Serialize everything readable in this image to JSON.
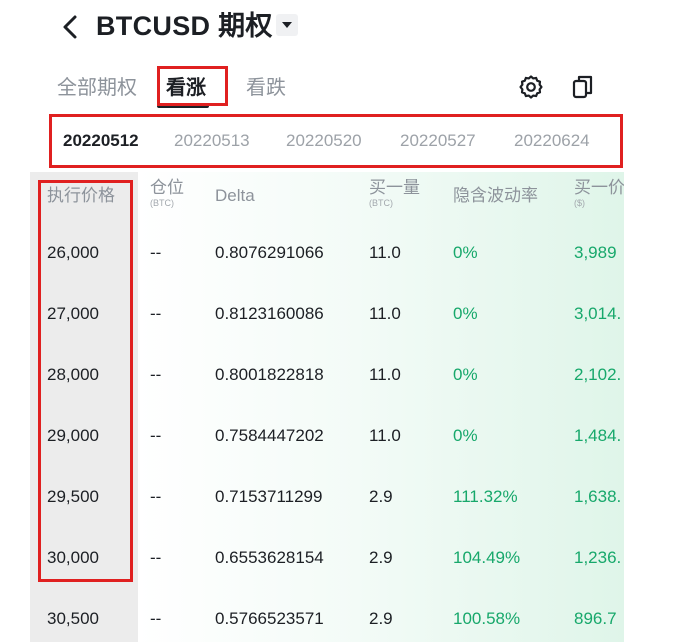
{
  "header": {
    "title": "BTCUSD 期权"
  },
  "tabs": {
    "all": "全部期权",
    "call": "看涨",
    "put": "看跌",
    "active": "看涨"
  },
  "expiries": [
    "20220512",
    "20220513",
    "20220520",
    "20220527",
    "20220624"
  ],
  "table": {
    "headers": {
      "strike": "执行价格",
      "position": "仓位",
      "position_unit": "(BTC)",
      "delta": "Delta",
      "bid_size": "买一量",
      "bid_size_unit": "(BTC)",
      "iv": "隐含波动率",
      "bid_price": "买一价",
      "bid_price_unit": "($)"
    },
    "rows": [
      {
        "strike": "26,000",
        "position": "--",
        "delta": "0.8076291066",
        "bid_size": "11.0",
        "iv": "0%",
        "bid_price": "3,989"
      },
      {
        "strike": "27,000",
        "position": "--",
        "delta": "0.8123160086",
        "bid_size": "11.0",
        "iv": "0%",
        "bid_price": "3,014."
      },
      {
        "strike": "28,000",
        "position": "--",
        "delta": "0.8001822818",
        "bid_size": "11.0",
        "iv": "0%",
        "bid_price": "2,102."
      },
      {
        "strike": "29,000",
        "position": "--",
        "delta": "0.7584447202",
        "bid_size": "11.0",
        "iv": "0%",
        "bid_price": "1,484."
      },
      {
        "strike": "29,500",
        "position": "--",
        "delta": "0.7153711299",
        "bid_size": "2.9",
        "iv": "111.32%",
        "bid_price": "1,638."
      },
      {
        "strike": "30,000",
        "position": "--",
        "delta": "0.6553628154",
        "bid_size": "2.9",
        "iv": "104.49%",
        "bid_price": "1,236."
      },
      {
        "strike": "30,500",
        "position": "--",
        "delta": "0.5766523571",
        "bid_size": "2.9",
        "iv": "100.58%",
        "bid_price": "896.7"
      }
    ]
  },
  "colors": {
    "accent_green": "#17a86b",
    "highlight_red": "#e02020",
    "text_primary": "#1c1f24",
    "text_muted": "#8d939b"
  }
}
